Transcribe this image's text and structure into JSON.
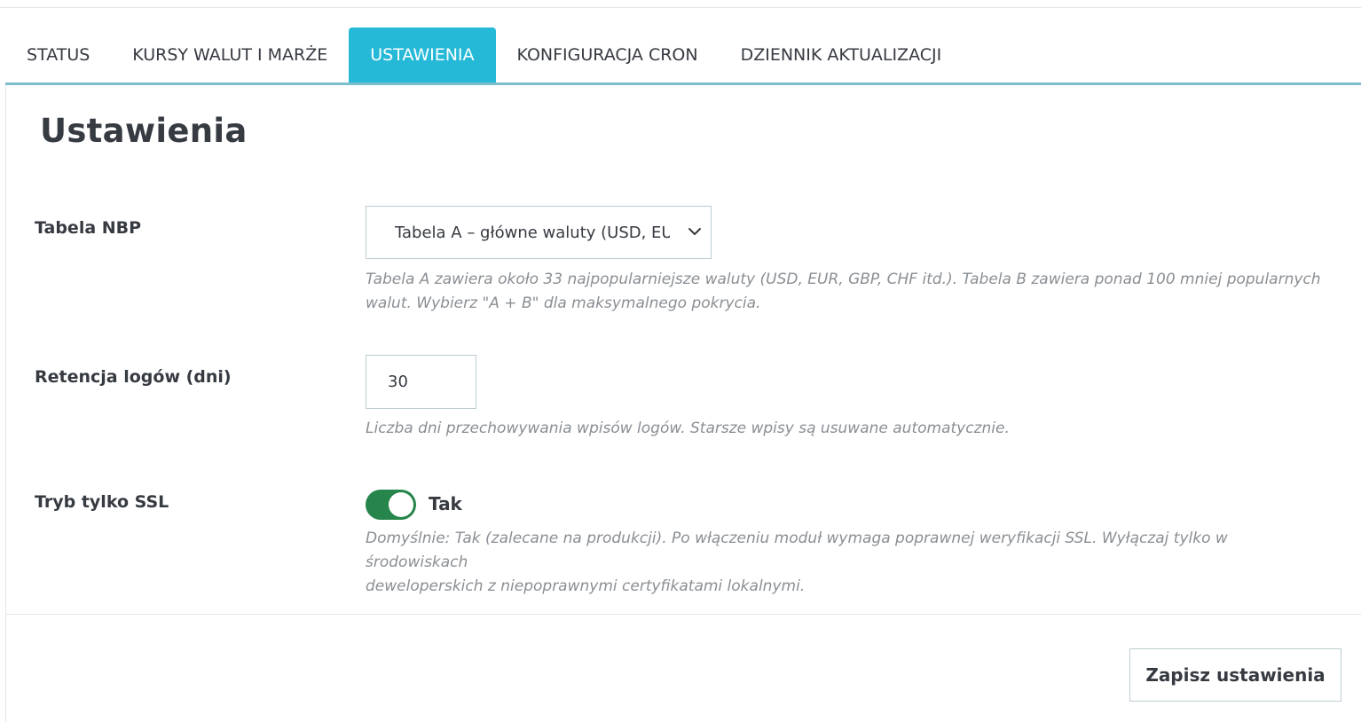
{
  "tabs": [
    {
      "label": "STATUS"
    },
    {
      "label": "KURSY WALUT I MARŻE"
    },
    {
      "label": "USTAWIENIA"
    },
    {
      "label": "KONFIGURACJA CRON"
    },
    {
      "label": "DZIENNIK AKTUALIZACJI"
    }
  ],
  "colors": {
    "active_tab": "#25b9d7",
    "tab_underline": "#7cbfcc",
    "switch_on": "#25854a",
    "help_text": "#8a8f94"
  },
  "page": {
    "title": "Ustawienia"
  },
  "nbp_table": {
    "label": "Tabela NBP",
    "selected": "Tabela A – główne waluty (USD, EUR",
    "help_line1": "Tabela A zawiera około 33 najpopularniejsze waluty (USD, EUR, GBP, CHF itd.). Tabela B zawiera ponad 100 mniej popularnych",
    "help_line2": "walut. Wybierz \"A + B\" dla maksymalnego pokrycia."
  },
  "log_retention": {
    "label": "Retencja logów (dni)",
    "value": "30",
    "help": "Liczba dni przechowywania wpisów logów. Starsze wpisy są usuwane automatycznie."
  },
  "ssl_only": {
    "label": "Tryb tylko SSL",
    "state_label": "Tak",
    "enabled": true,
    "help_line1": "Domyślnie: Tak (zalecane na produkcji). Po włączeniu moduł wymaga poprawnej weryfikacji SSL. Wyłączaj tylko w środowiskach",
    "help_line2": "deweloperskich z niepoprawnymi certyfikatami lokalnymi."
  },
  "footer": {
    "save_label": "Zapisz ustawienia"
  }
}
